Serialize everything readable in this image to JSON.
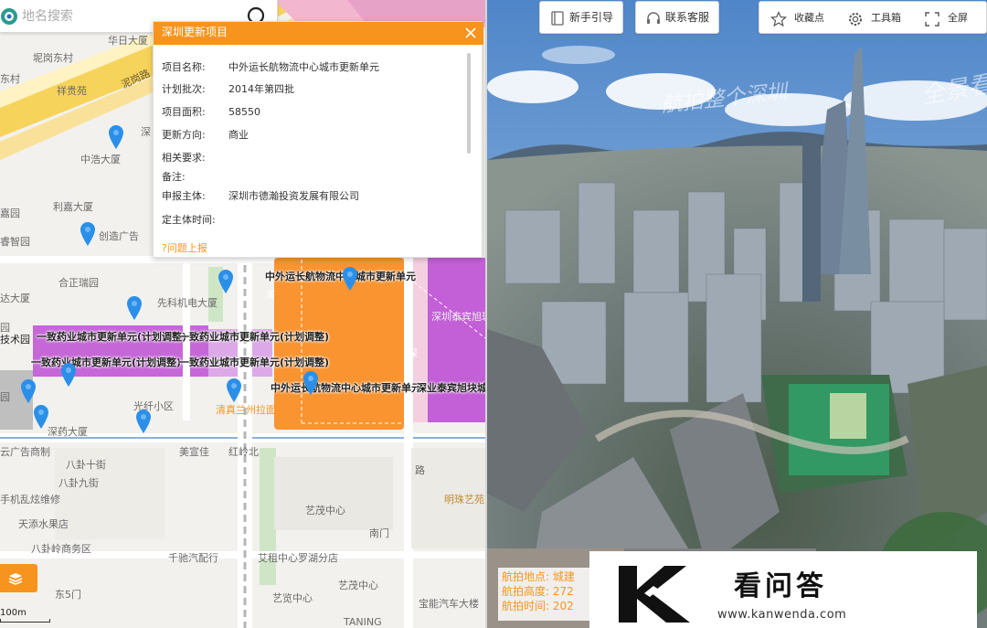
{
  "search": {
    "placeholder": "地名搜索"
  },
  "popup": {
    "title": "深圳更新项目",
    "rows": [
      {
        "label": "项目名称:",
        "value": "中外运长航物流中心城市更新单元"
      },
      {
        "label": "计划批次:",
        "value": "2014年第四批"
      },
      {
        "label": "项目面积:",
        "value": "58550"
      },
      {
        "label": "更新方向:",
        "value": "商业"
      },
      {
        "label": "相关要求:",
        "value": ""
      },
      {
        "label": "备注:",
        "value": ""
      },
      {
        "label": "申报主体:",
        "value": "深圳市德瀚投资发展有限公司"
      },
      {
        "label": "定主体时间:",
        "value": ""
      }
    ],
    "report": "问题上报"
  },
  "map": {
    "labels": [
      "华日大厦",
      "坭岗东村",
      "东村",
      "祥贵苑",
      "中浩大厦",
      "利嘉大厦",
      "嘉园",
      "创造广告",
      "睿智园",
      "合正瑞园",
      "达大厦",
      "先科机电大厦",
      "园",
      "技术园",
      "光纤小区",
      "园",
      "深药大厦",
      "清真兰州拉面",
      "云广告商制",
      "美宣佳",
      "红岭北",
      "八卦十街",
      "八卦九街",
      "手机乱炫维修",
      "天添水果店",
      "八卦岭商务区",
      "东5门",
      "艺茂中心",
      "南门",
      "艺茂中心",
      "千驰汽配行",
      "艾租中心罗湖分店",
      "宝能汽车大楼",
      "艺览中心",
      "TANING",
      "深圳泰宾旭玻璃",
      "明珠艺苑",
      "深",
      "路",
      "深",
      "泥岗路",
      "浦"
    ],
    "highlights": [
      "中外运长航物流中心城市更新单元",
      "一致药业城市更新单元(计划调整)",
      "一致药业城市更新单元(计划调整)",
      "一致药业城市更新单元(计划调整)",
      "一致药业城市更新单元(计划调整)",
      "中外运长航物流中心城市更新单元",
      "深业泰宾旭块城"
    ],
    "scale": "100m"
  },
  "pano": {
    "buttons": {
      "guide": "新手引导",
      "service": "联系客服",
      "favorite": "收藏点",
      "tools": "工具箱",
      "fullscreen": "全屏"
    },
    "watermarks": [
      "航拍整个深圳",
      "全景看"
    ],
    "info": {
      "place": "航拍地点: 城建",
      "height": "航拍高度: 272",
      "time": "航拍时间: 202"
    }
  },
  "watermark": {
    "name": "看问答",
    "url": "www.kanwenda.com"
  },
  "colors": {
    "accent": "#f7941d",
    "purple": "#c96adb",
    "orange_zone": "#f98e27"
  }
}
